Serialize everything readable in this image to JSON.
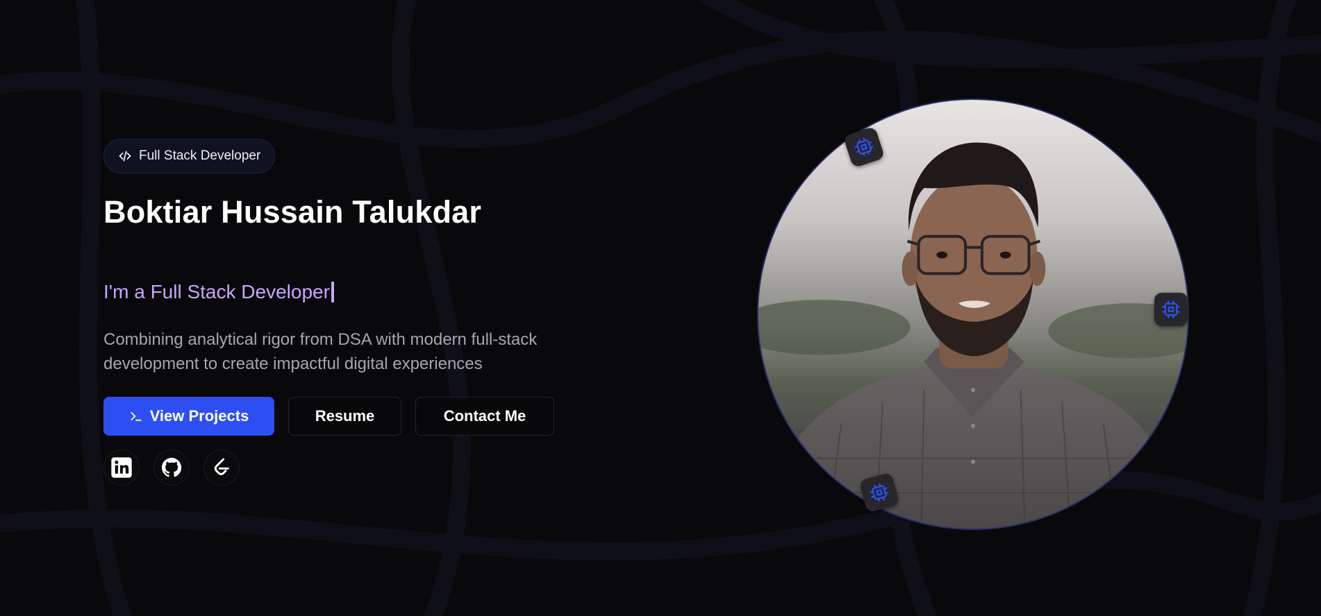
{
  "hero": {
    "badge_label": "Full Stack Developer",
    "name": "Boktiar Hussain Talukdar",
    "typed_text": "I'm a Full Stack Developer",
    "description": "Combining analytical rigor from DSA with modern full-stack development to create impactful digital experiences",
    "buttons": {
      "view_projects": "View Projects",
      "resume": "Resume",
      "contact": "Contact Me"
    },
    "socials": [
      "linkedin-icon",
      "github-icon",
      "leetcode-icon"
    ]
  },
  "profile": {
    "photo_alt": "Profile photo",
    "chip_icon": "cpu-chip-icon"
  },
  "colors": {
    "background": "#09080b",
    "accent": "#2d4ff2",
    "typed_text": "#c9a6ff",
    "description": "#a7a6ae"
  }
}
